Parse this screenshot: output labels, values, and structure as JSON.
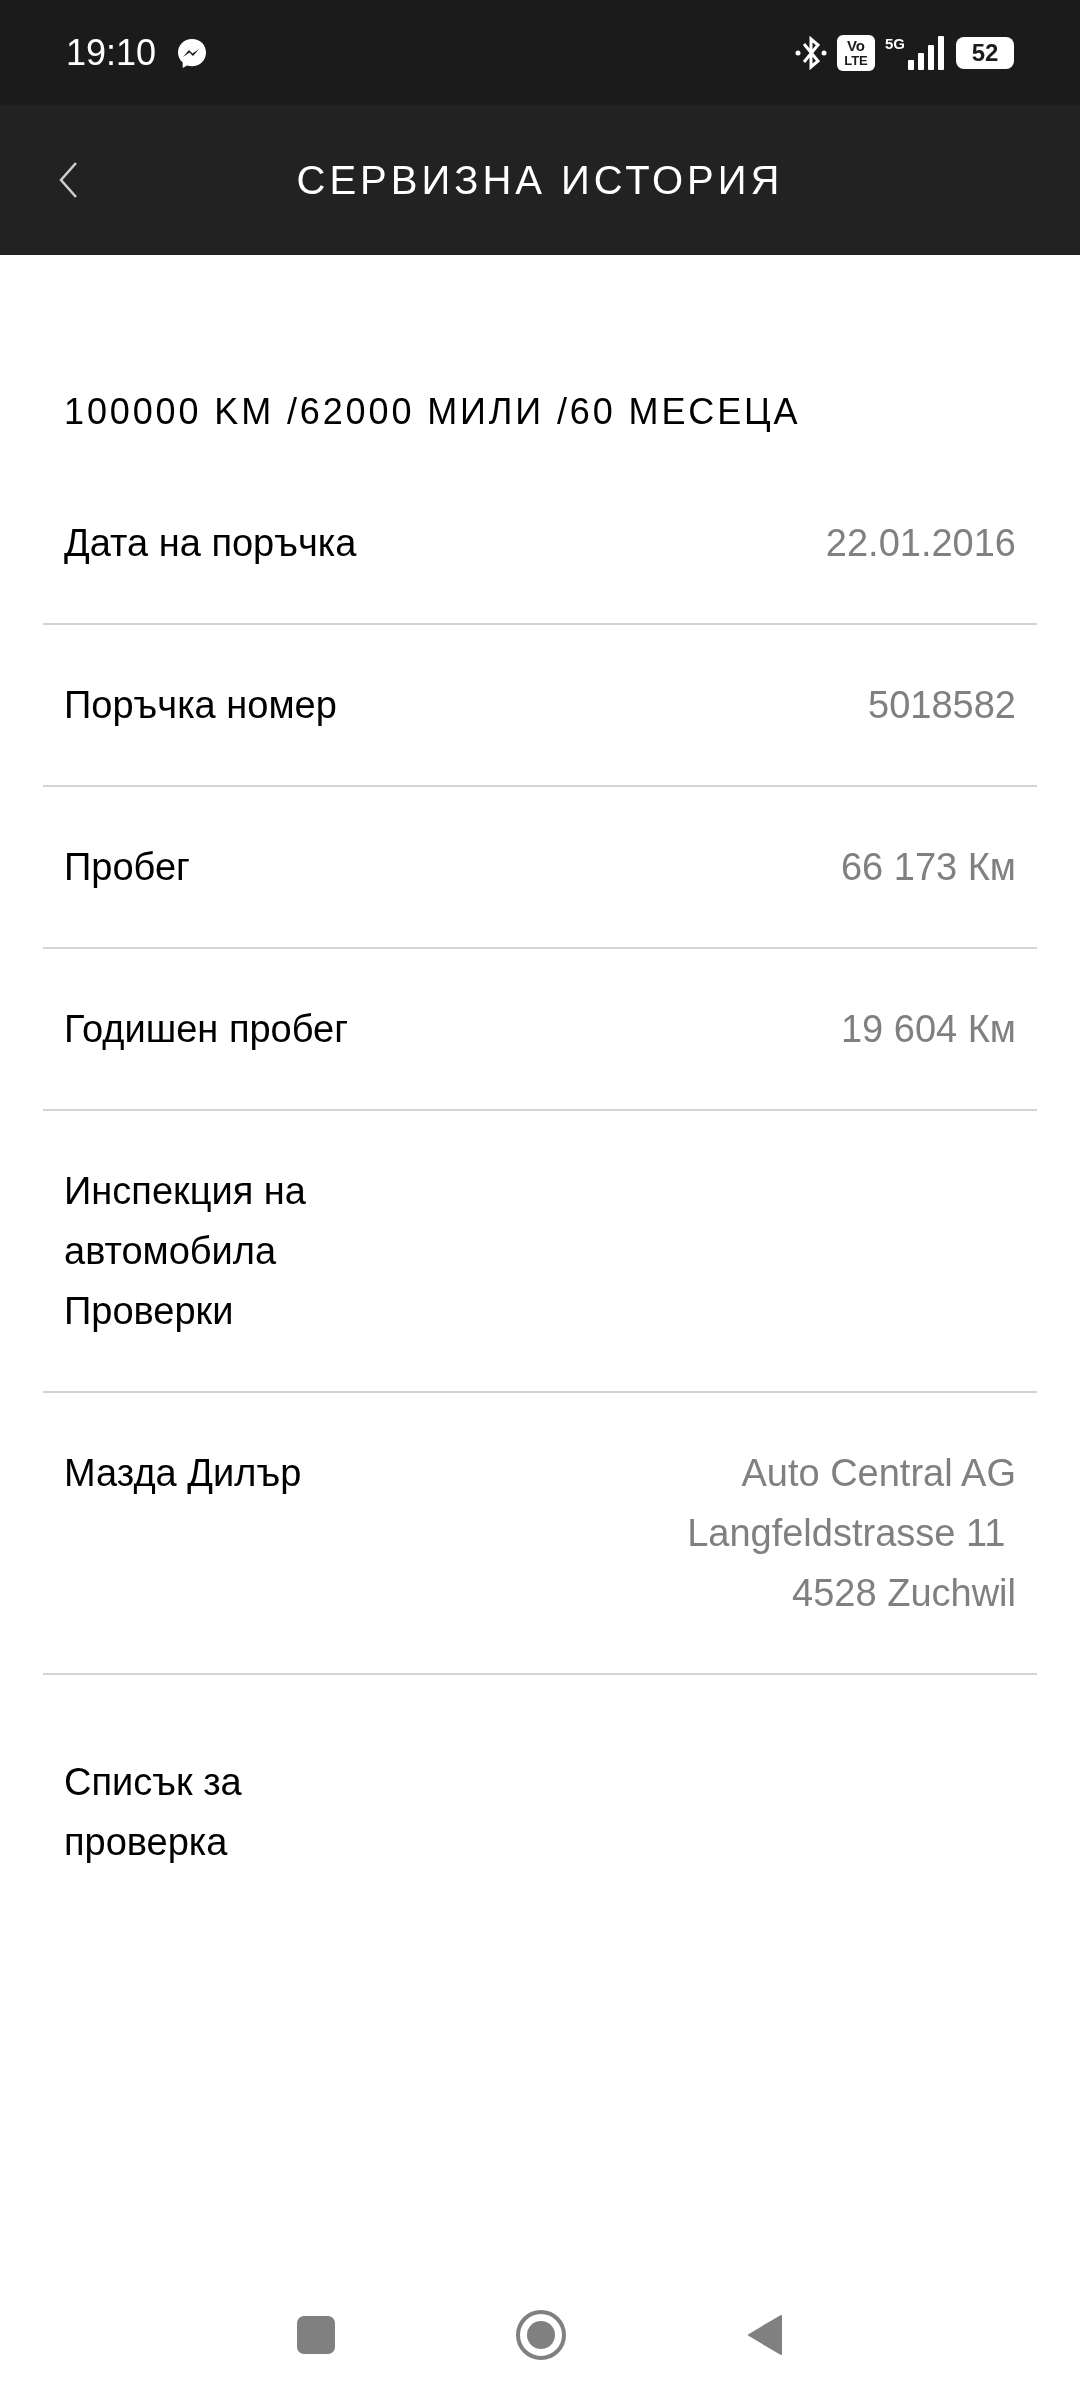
{
  "status_bar": {
    "time": "19:10",
    "volte_top": "Vo",
    "volte_bottom": "LTE",
    "network": "5G",
    "battery": "52"
  },
  "header": {
    "title": "СЕРВИЗНА ИСТОРИЯ"
  },
  "section_title": "100000 KM /62000 МИЛИ /60 МЕСЕЦА",
  "rows": [
    {
      "label": "Дата на поръчка",
      "value": [
        "22.01.2016"
      ]
    },
    {
      "label": "Поръчка номер",
      "value": [
        "5018582"
      ]
    },
    {
      "label": "Пробег",
      "value": [
        "66 173 Км"
      ]
    },
    {
      "label": "Годишен пробег",
      "value": [
        "19 604 Км"
      ]
    },
    {
      "label": "Инспекция на автомобила\nПроверки",
      "value": []
    },
    {
      "label": "Мазда Дилър",
      "value": [
        "Auto Central AG",
        "Langfeldstrasse 11 ",
        "4528 Zuchwil"
      ]
    }
  ],
  "checklist": {
    "label": "Списък за проверка"
  }
}
